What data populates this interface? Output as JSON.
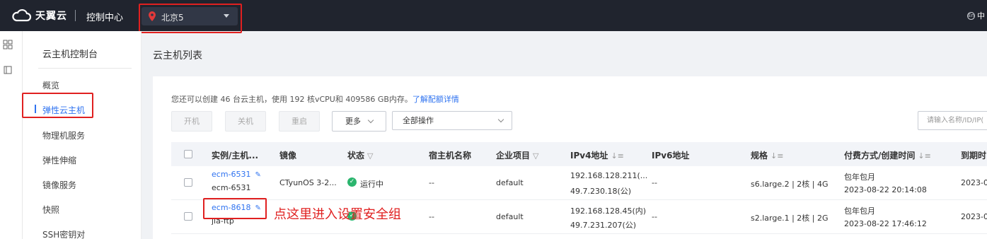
{
  "topbar": {
    "brand": "天翼云",
    "console": "控制中心",
    "region": "北京5",
    "lang": "中"
  },
  "sidebar": {
    "title": "云主机控制台",
    "items": [
      {
        "label": "概览",
        "active": false
      },
      {
        "label": "弹性云主机",
        "active": true
      },
      {
        "label": "物理机服务",
        "active": false
      },
      {
        "label": "弹性伸缩",
        "active": false
      },
      {
        "label": "镜像服务",
        "active": false
      },
      {
        "label": "快照",
        "active": false
      },
      {
        "label": "SSH密钥对",
        "active": false
      }
    ]
  },
  "main": {
    "title": "云主机列表",
    "quota_text": "您还可以创建 46 台云主机，使用 192 核vCPU和 409586 GB内存。",
    "quota_link": "了解配额详情",
    "buttons": {
      "start": "开机",
      "stop": "关机",
      "restart": "重启",
      "more": "更多",
      "all_ops": "全部操作"
    },
    "search_placeholder": "请输入名称/ID/IP(",
    "columns": [
      "实例/主机...",
      "镜像",
      "状态",
      "宿主机名称",
      "企业项目",
      "IPv4地址",
      "IPv6地址",
      "规格",
      "付费方式/创建时间",
      "到期时"
    ],
    "rows": [
      {
        "instance_id": "ecm-6531",
        "host_name": "ecm-6531",
        "image": "CTyunOS 3-2...",
        "status": "运行中",
        "host": "--",
        "project": "default",
        "ipv4_private": "192.168.128.211(...",
        "ipv4_public": "49.7.230.18(公)",
        "ipv6": "--",
        "spec": "s6.large.2 | 2核 | 4G",
        "billing": "包年包月",
        "created": "2023-08-22 20:14:08",
        "expire": "2023-0"
      },
      {
        "instance_id": "ecm-8618",
        "host_name": "jia-ftp",
        "image": "",
        "status": "",
        "host": "--",
        "project": "default",
        "ipv4_private": "192.168.128.45(内)",
        "ipv4_public": "49.7.231.207(公)",
        "ipv6": "--",
        "spec": "s2.large.1 | 2核 | 2G",
        "billing": "包年包月",
        "created": "2023-08-22 17:46:12",
        "expire": "2023-0"
      }
    ]
  },
  "annotation": "点这里进入设置安全组",
  "colors": {
    "topbar": "#20242e",
    "accent": "#2f73f0",
    "annotation_red": "#e02020",
    "status_green": "#2bb56e"
  }
}
